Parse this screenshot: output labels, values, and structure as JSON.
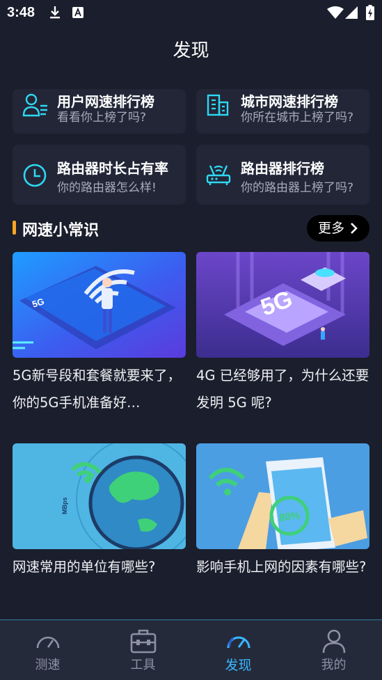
{
  "status_bar": {
    "time": "3:48"
  },
  "header": {
    "title": "发现"
  },
  "cards": [
    {
      "title": "用户网速排行榜",
      "subtitle": "看看你上榜了吗?"
    },
    {
      "title": "城市网速排行榜",
      "subtitle": "你所在城市上榜了吗?"
    },
    {
      "title": "路由器时长占有率",
      "subtitle": "你的路由器怎么样!"
    },
    {
      "title": "路由器排行榜",
      "subtitle": "你的路由器上榜了吗?"
    }
  ],
  "section": {
    "title": "网速小常识",
    "more_label": "更多"
  },
  "articles": [
    {
      "title": "5G新号段和套餐就要来了，你的5G手机准备好…"
    },
    {
      "title": "4G 已经够用了，为什么还要发明 5G 呢?"
    },
    {
      "title": "网速常用的单位有哪些?"
    },
    {
      "title": "影响手机上网的因素有哪些?"
    }
  ],
  "thumb_text": {
    "a1": "5G",
    "a2": "5G",
    "a3": "MBps",
    "a4": "80%"
  },
  "nav": {
    "items": [
      {
        "label": "测速"
      },
      {
        "label": "工具"
      },
      {
        "label": "发现"
      },
      {
        "label": "我的"
      }
    ],
    "active": "发现"
  },
  "colors": {
    "accent": "#39b8ff",
    "icon_cyan": "#2fd8f2",
    "section_bar": "#f5a623",
    "background": "#1b1e2c",
    "card": "#222637"
  }
}
